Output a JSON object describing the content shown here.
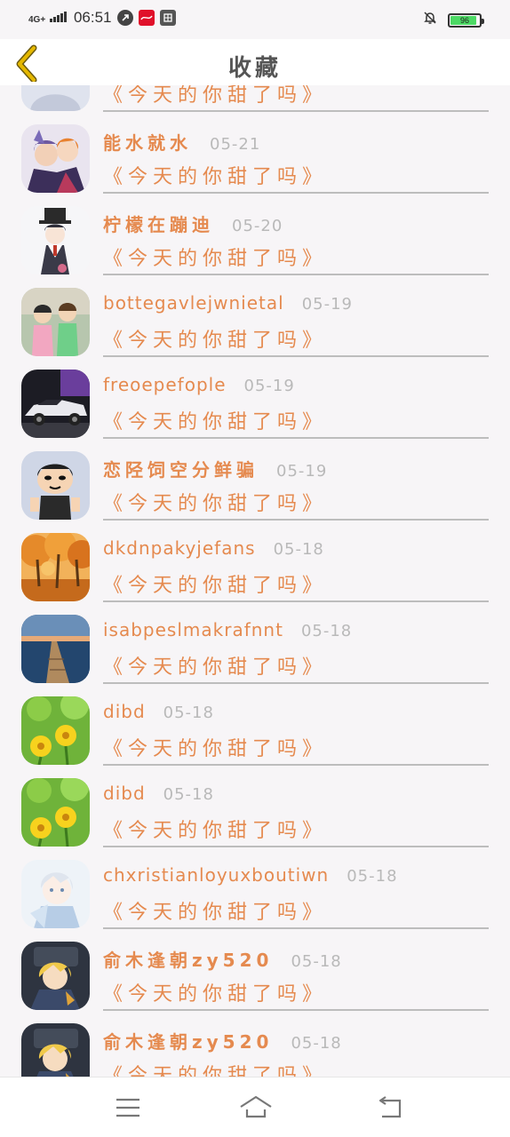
{
  "status_bar": {
    "network": "4G+",
    "time": "06:51",
    "battery": "96",
    "battery_level": 0.96,
    "battery_color": "#4cd964"
  },
  "header": {
    "title": "收藏",
    "back_icon": "chevron-left-icon"
  },
  "colors": {
    "accent": "#e58a4f",
    "muted": "#b9b9b9",
    "divider": "#bdbdbd",
    "back_icon": "#e5b800"
  },
  "items": [
    {
      "name": "",
      "date": "",
      "title": "《今天的你甜了吗》",
      "avatar": "default-avatar"
    },
    {
      "name": "能水就水",
      "date": "05-21",
      "title": "《今天的你甜了吗》",
      "avatar": "anime-pair-avatar"
    },
    {
      "name": "柠檬在蹦迪",
      "date": "05-20",
      "title": "《今天的你甜了吗》",
      "avatar": "anime-top-hat-avatar"
    },
    {
      "name": "bottegavlejwnietal",
      "date": "05-19",
      "title": "《今天的你甜了吗》",
      "avatar": "cartoon-kids-avatar"
    },
    {
      "name": "freoepefople",
      "date": "05-19",
      "title": "《今天的你甜了吗》",
      "avatar": "sports-car-avatar"
    },
    {
      "name": "恋陉饲空分鲜骗",
      "date": "05-19",
      "title": "《今天的你甜了吗》",
      "avatar": "cartoon-boy-avatar"
    },
    {
      "name": "dkdnpakyjefans",
      "date": "05-18",
      "title": "《今天的你甜了吗》",
      "avatar": "autumn-trees-avatar"
    },
    {
      "name": "isabpeslmakrafnnt",
      "date": "05-18",
      "title": "《今天的你甜了吗》",
      "avatar": "lake-pier-avatar"
    },
    {
      "name": "dibd",
      "date": "05-18",
      "title": "《今天的你甜了吗》",
      "avatar": "yellow-flowers-avatar"
    },
    {
      "name": "dibd",
      "date": "05-18",
      "title": "《今天的你甜了吗》",
      "avatar": "yellow-flowers-avatar"
    },
    {
      "name": "chxristianloyuxboutiwn",
      "date": "05-18",
      "title": "《今天的你甜了吗》",
      "avatar": "anime-white-hair-avatar"
    },
    {
      "name": "俞木逢朝zy520",
      "date": "05-18",
      "title": "《今天的你甜了吗》",
      "avatar": "anime-blond-avatar"
    },
    {
      "name": "俞木逢朝zy520",
      "date": "05-18",
      "title": "《今天的你甜了吗》",
      "avatar": "anime-blond-avatar"
    }
  ],
  "nav": {
    "menu_icon": "menu-icon",
    "home_icon": "home-icon",
    "back_icon": "back-icon"
  }
}
